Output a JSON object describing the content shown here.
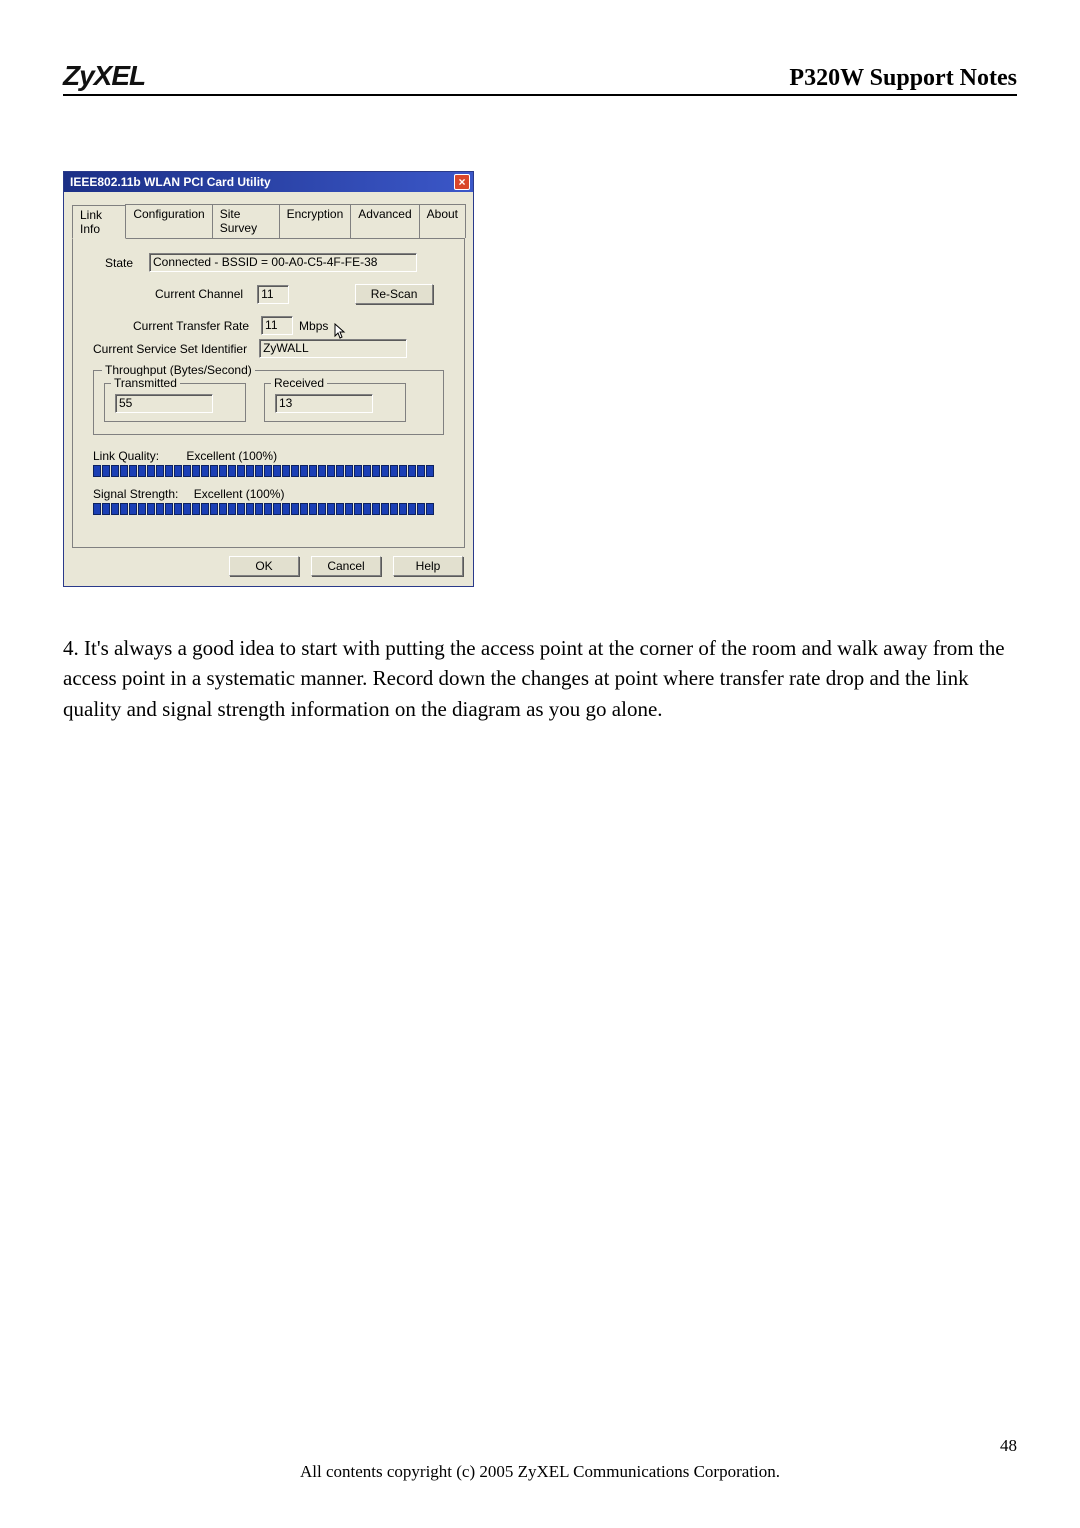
{
  "header": {
    "logo_text": "ZyXEL",
    "doc_title": "P320W Support Notes"
  },
  "dialog": {
    "title": "IEEE802.11b WLAN PCI Card Utility",
    "close_icon": "×",
    "tabs": [
      "Link Info",
      "Configuration",
      "Site Survey",
      "Encryption",
      "Advanced",
      "About"
    ],
    "active_tab_index": 0,
    "state_label": "State",
    "state_value": "Connected - BSSID = 00-A0-C5-4F-FE-38",
    "current_channel_label": "Current Channel",
    "current_channel_value": "11",
    "rescan_label": "Re-Scan",
    "transfer_rate_label": "Current Transfer Rate",
    "transfer_rate_value": "11",
    "transfer_rate_unit": "Mbps",
    "ssid_label": "Current Service Set Identifier",
    "ssid_value": "ZyWALL",
    "throughput_group": "Throughput (Bytes/Second)",
    "transmitted_label": "Transmitted",
    "transmitted_value": "55",
    "received_label": "Received",
    "received_value": "13",
    "link_quality_label": "Link Quality:",
    "link_quality_value": "Excellent (100%)",
    "signal_strength_label": "Signal Strength:",
    "signal_strength_value": "Excellent (100%)",
    "ok_label": "OK",
    "cancel_label": "Cancel",
    "help_label": "Help"
  },
  "body_text": "4. It's always a good idea to start with putting the access point at the corner of the room and walk away from the access point in a systematic manner. Record down the changes at point where transfer rate drop and the link quality and signal strength information on the diagram as you go alone.",
  "footer": {
    "page_number": "48",
    "copyright": "All contents copyright (c) 2005 ZyXEL Communications Corporation."
  },
  "chart_data": {
    "type": "bar",
    "series": [
      {
        "name": "Link Quality",
        "value_percent": 100,
        "display": "Excellent (100%)"
      },
      {
        "name": "Signal Strength",
        "value_percent": 100,
        "display": "Excellent (100%)"
      }
    ],
    "segments_per_bar": 38
  }
}
